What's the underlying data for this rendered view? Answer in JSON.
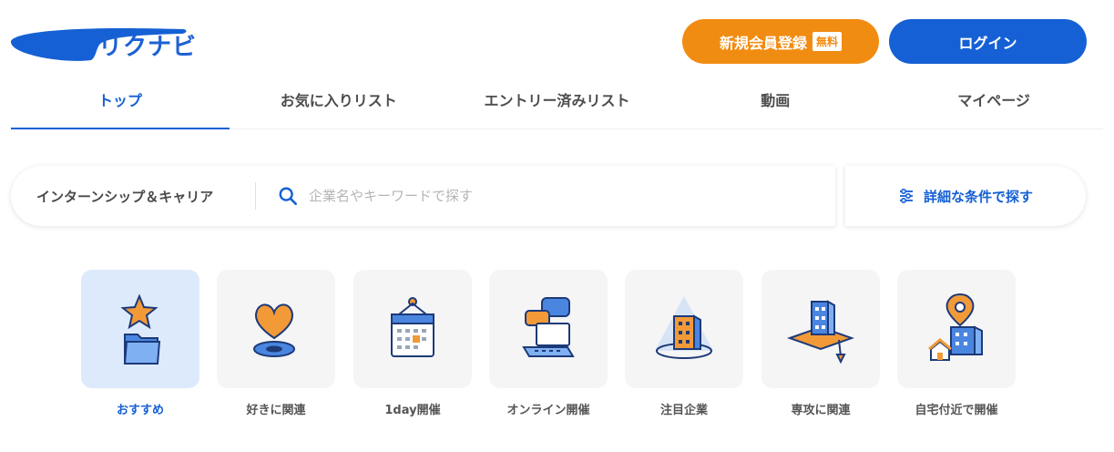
{
  "brand": {
    "logo_text": "リクナビ",
    "primary": "#1560d4",
    "accent": "#f18c12"
  },
  "header": {
    "register_label": "新規会員登録",
    "free_badge": "無料",
    "login_label": "ログイン"
  },
  "nav": {
    "items": [
      {
        "label": "トップ"
      },
      {
        "label": "お気に入りリスト"
      },
      {
        "label": "エントリー済みリスト"
      },
      {
        "label": "動画"
      },
      {
        "label": "マイページ"
      }
    ],
    "active": "トップ"
  },
  "search": {
    "category": "インターンシップ＆キャリア",
    "placeholder": "企業名やキーワードで探す",
    "detail_label": "詳細な条件で探す"
  },
  "categories": [
    {
      "label": "おすすめ",
      "icon": "star-folder-icon",
      "active": true
    },
    {
      "label": "好きに関連",
      "icon": "heart-icon"
    },
    {
      "label": "1day開催",
      "icon": "calendar-icon"
    },
    {
      "label": "オンライン開催",
      "icon": "laptop-chat-icon"
    },
    {
      "label": "注目企業",
      "icon": "spotlight-building-icon"
    },
    {
      "label": "専攻に関連",
      "icon": "graduation-building-icon"
    },
    {
      "label": "自宅付近で開催",
      "icon": "map-pin-house-icon"
    }
  ]
}
